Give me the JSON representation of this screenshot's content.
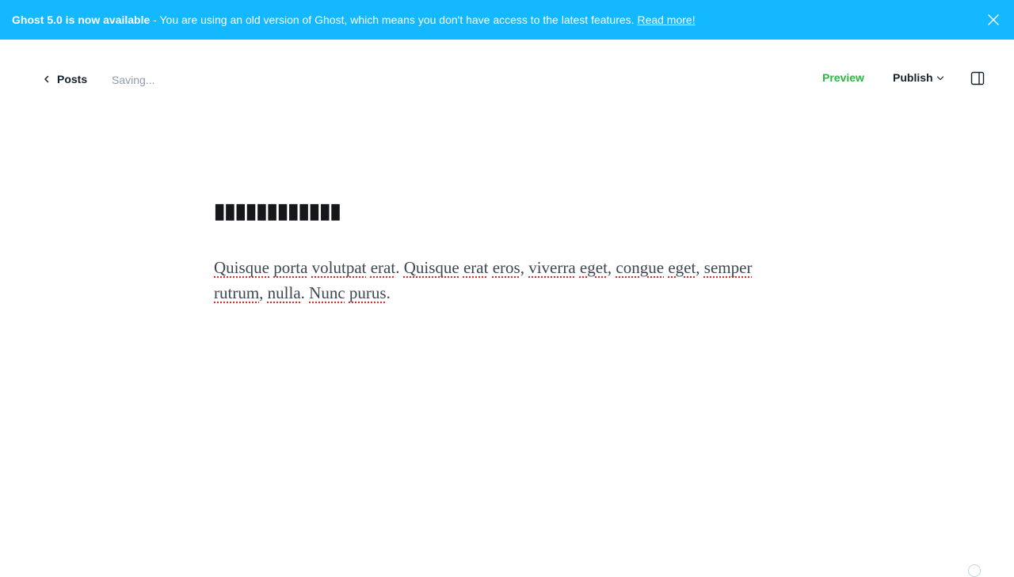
{
  "banner": {
    "headline": "Ghost 5.0 is now available",
    "message": " - You are using an old version of Ghost, which means you don't have access to the latest features. ",
    "link_label": "Read more!",
    "close_icon": "close-icon",
    "background": "#14b8ff"
  },
  "header": {
    "back_label": "Posts",
    "back_icon": "chevron-left-icon",
    "status": "Saving...",
    "preview_label": "Preview",
    "publish_label": "Publish",
    "publish_icon": "chevron-down-icon",
    "sidebar_icon": "sidebar-panel-icon",
    "preview_color": "#2bb741"
  },
  "editor": {
    "title": "▮▮▮▮▮▮▮▮▮▮▮▮",
    "body_words": [
      " ",
      "Quisque",
      " ",
      "porta",
      " ",
      "volutpat",
      " ",
      "erat",
      ". ",
      "Quisque",
      " ",
      "erat",
      " ",
      "eros",
      ", ",
      "viverra",
      " ",
      "eget",
      ", ",
      "congue",
      " ",
      "eget",
      ", ",
      "semper",
      " ",
      "rutrum",
      ", ",
      "nulla",
      ". ",
      "Nunc",
      " ",
      "purus",
      "."
    ]
  }
}
